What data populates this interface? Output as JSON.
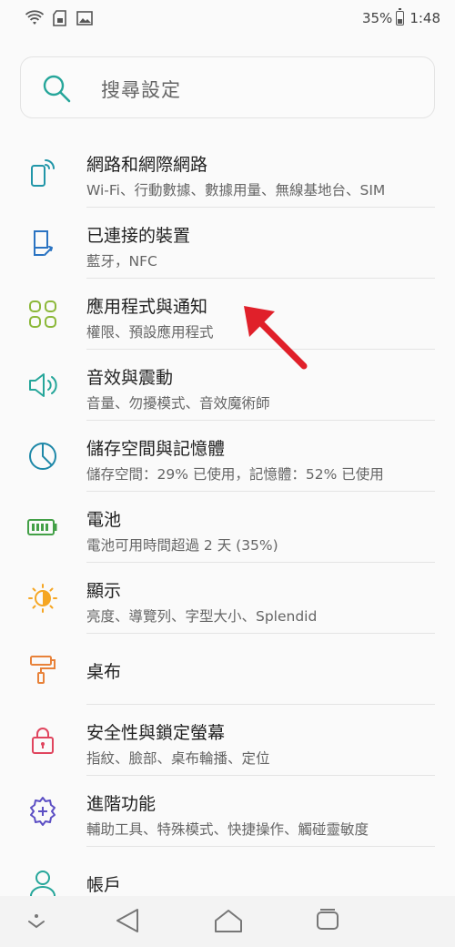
{
  "status_bar": {
    "battery_percent": "35%",
    "battery_level": 0.35,
    "time": "1:48",
    "left_icons": [
      "wifi-icon",
      "sd-card-icon",
      "image-icon"
    ]
  },
  "search": {
    "placeholder": "搜尋設定"
  },
  "settings": [
    {
      "id": "network",
      "icon": "network-icon",
      "color": "#2196a8",
      "title": "網路和網際網路",
      "subtitle": "Wi-Fi、行動數據、數據用量、無線基地台、SIM"
    },
    {
      "id": "connected-devices",
      "icon": "devices-icon",
      "color": "#2a73c2",
      "title": "已連接的裝置",
      "subtitle": "藍牙，NFC"
    },
    {
      "id": "apps-notifications",
      "icon": "apps-grid-icon",
      "color": "#8cb83a",
      "title": "應用程式與通知",
      "subtitle": "權限、預設應用程式"
    },
    {
      "id": "sound",
      "icon": "speaker-icon",
      "color": "#26a69a",
      "title": "音效與震動",
      "subtitle": "音量、勿擾模式、音效魔術師"
    },
    {
      "id": "storage",
      "icon": "storage-pie-icon",
      "color": "#1e88a8",
      "title": "儲存空間與記憶體",
      "subtitle": "儲存空間：29% 已使用，記憶體：52% 已使用"
    },
    {
      "id": "battery",
      "icon": "battery-icon",
      "color": "#43a047",
      "title": "電池",
      "subtitle": "電池可用時間超過 2 天 (35%)"
    },
    {
      "id": "display",
      "icon": "brightness-icon",
      "color": "#f5a623",
      "title": "顯示",
      "subtitle": "亮度、導覽列、字型大小、Splendid"
    },
    {
      "id": "wallpaper",
      "icon": "paint-roller-icon",
      "color": "#e8823a",
      "title": "桌布",
      "subtitle": ""
    },
    {
      "id": "security",
      "icon": "lock-icon",
      "color": "#e0455e",
      "title": "安全性與鎖定螢幕",
      "subtitle": "指紋、臉部、桌布輪播、定位"
    },
    {
      "id": "advanced",
      "icon": "advanced-gear-icon",
      "color": "#5c4fc4",
      "title": "進階功能",
      "subtitle": "輔助工具、特殊模式、快捷操作、觸碰靈敏度"
    },
    {
      "id": "accounts",
      "icon": "account-icon",
      "color": "#26a69a",
      "title": "帳戶",
      "subtitle": ""
    }
  ],
  "annotation": {
    "icon": "red-arrow-icon",
    "color": "#e0202a"
  },
  "nav_bar": {
    "buttons": [
      "expand-down-icon",
      "back-icon",
      "home-icon",
      "recents-icon"
    ]
  }
}
